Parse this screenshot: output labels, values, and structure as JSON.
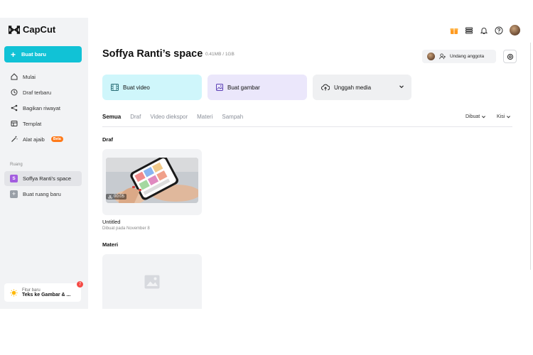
{
  "sidebar": {
    "logo": "CapCut",
    "create_label": "Buat baru",
    "nav": [
      {
        "label": "Mulai"
      },
      {
        "label": "Draf terbaru"
      },
      {
        "label": "Bagikan riwayat"
      },
      {
        "label": "Templat"
      },
      {
        "label": "Alat ajaib",
        "badge": "Beta"
      }
    ],
    "section_label": "Ruang",
    "space_badge": "S",
    "space_name": "Soffya Ranti's space",
    "new_space_label": "Buat ruang baru",
    "feature": {
      "small": "Fitur baru",
      "big": "Teks ke Gambar & ...",
      "count": "7"
    }
  },
  "header": {
    "title": "Soffya Ranti’s space",
    "storage": "0.41MB / 1GB",
    "invite_label": "Undang anggota"
  },
  "actions": {
    "video": "Buat video",
    "image": "Buat gambar",
    "upload": "Unggah media"
  },
  "tabs": [
    "Semua",
    "Draf",
    "Video diekspor",
    "Materi",
    "Sampah"
  ],
  "sort": {
    "created": "Dibuat",
    "grid": "Kisi"
  },
  "drafts": {
    "heading": "Draf",
    "item": {
      "duration": "00:05",
      "name": "Untitled",
      "date": "Dibuat pada November 8"
    }
  },
  "materials": {
    "heading": "Materi"
  },
  "colors": {
    "accent": "#11c2d6",
    "space_badge": "#a35ddf",
    "beta": "#ff7a1a"
  }
}
